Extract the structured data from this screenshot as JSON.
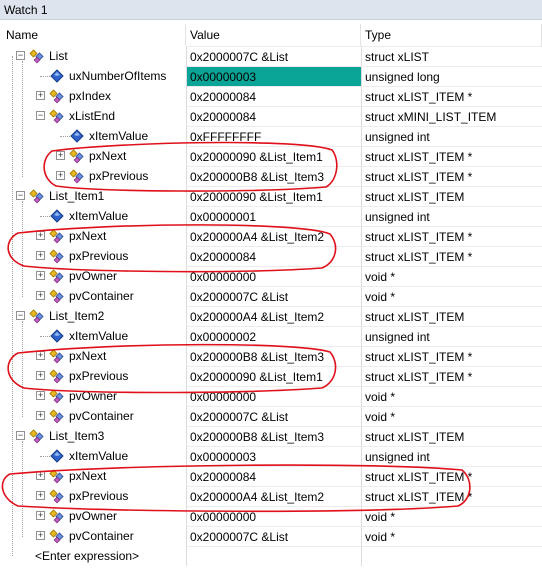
{
  "window": {
    "title": "Watch 1"
  },
  "columns": {
    "name": "Name",
    "value": "Value",
    "type": "Type"
  },
  "rows": [
    {
      "name": "List",
      "value": "0x2000007C &List",
      "type": "struct xLIST"
    },
    {
      "name": "uxNumberOfItems",
      "value": "0x00000003",
      "type": "unsigned long"
    },
    {
      "name": "pxIndex",
      "value": "0x20000084",
      "type": "struct xLIST_ITEM *"
    },
    {
      "name": "xListEnd",
      "value": "0x20000084",
      "type": "struct xMINI_LIST_ITEM"
    },
    {
      "name": "xItemValue",
      "value": "0xFFFFFFFF",
      "type": "unsigned int"
    },
    {
      "name": "pxNext",
      "value": "0x20000090 &List_Item1",
      "type": "struct xLIST_ITEM *"
    },
    {
      "name": "pxPrevious",
      "value": "0x200000B8 &List_Item3",
      "type": "struct xLIST_ITEM *"
    },
    {
      "name": "List_Item1",
      "value": "0x20000090 &List_Item1",
      "type": "struct xLIST_ITEM"
    },
    {
      "name": "xItemValue",
      "value": "0x00000001",
      "type": "unsigned int"
    },
    {
      "name": "pxNext",
      "value": "0x200000A4 &List_Item2",
      "type": "struct xLIST_ITEM *"
    },
    {
      "name": "pxPrevious",
      "value": "0x20000084",
      "type": "struct xLIST_ITEM *"
    },
    {
      "name": "pvOwner",
      "value": "0x00000000",
      "type": "void *"
    },
    {
      "name": "pvContainer",
      "value": "0x2000007C &List",
      "type": "void *"
    },
    {
      "name": "List_Item2",
      "value": "0x200000A4 &List_Item2",
      "type": "struct xLIST_ITEM"
    },
    {
      "name": "xItemValue",
      "value": "0x00000002",
      "type": "unsigned int"
    },
    {
      "name": "pxNext",
      "value": "0x200000B8 &List_Item3",
      "type": "struct xLIST_ITEM *"
    },
    {
      "name": "pxPrevious",
      "value": "0x20000090 &List_Item1",
      "type": "struct xLIST_ITEM *"
    },
    {
      "name": "pvOwner",
      "value": "0x00000000",
      "type": "void *"
    },
    {
      "name": "pvContainer",
      "value": "0x2000007C &List",
      "type": "void *"
    },
    {
      "name": "List_Item3",
      "value": "0x200000B8 &List_Item3",
      "type": "struct xLIST_ITEM"
    },
    {
      "name": "xItemValue",
      "value": "0x00000003",
      "type": "unsigned int"
    },
    {
      "name": "pxNext",
      "value": "0x20000084",
      "type": "struct xLIST_ITEM *"
    },
    {
      "name": "pxPrevious",
      "value": "0x200000A4 &List_Item2",
      "type": "struct xLIST_ITEM *"
    },
    {
      "name": "pvOwner",
      "value": "0x00000000",
      "type": "void *"
    },
    {
      "name": "pvContainer",
      "value": "0x2000007C &List",
      "type": "void *"
    },
    {
      "name": "<Enter expression>",
      "value": "",
      "type": ""
    }
  ],
  "colors": {
    "highlight": "#0aa596",
    "annotation": "#e0101a"
  }
}
